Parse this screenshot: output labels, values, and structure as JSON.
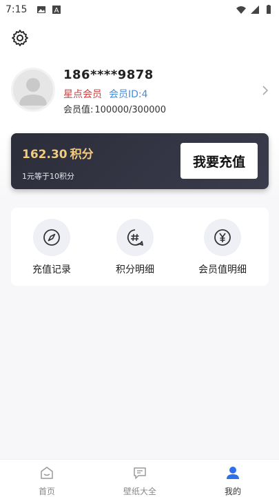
{
  "status_bar": {
    "time": "7:15",
    "icons_left": [
      "image-icon",
      "text-icon"
    ],
    "icons_right": [
      "wifi-icon",
      "signal-icon",
      "battery-icon"
    ]
  },
  "settings": {
    "icon": "gear-icon"
  },
  "profile": {
    "phone": "186****9878",
    "level": "星点会员",
    "member_id": "会员ID:4",
    "points_label": "会员值:",
    "points_value": "100000/300000"
  },
  "recharge": {
    "balance": "162.30",
    "balance_unit": "积分",
    "rate": "1元等于10积分",
    "button_label": "我要充值"
  },
  "menu": [
    {
      "label": "充值记录",
      "icon": "compass-icon"
    },
    {
      "label": "积分明细",
      "icon": "hashtag-chat-icon"
    },
    {
      "label": "会员值明细",
      "icon": "yen-icon"
    }
  ],
  "nav": [
    {
      "label": "首页",
      "icon": "home-icon",
      "active": false
    },
    {
      "label": "壁纸大全",
      "icon": "message-icon",
      "active": false
    },
    {
      "label": "我的",
      "icon": "user-icon",
      "active": true
    }
  ],
  "colors": {
    "level": "#c84040",
    "member_id": "#4a8ad6",
    "balance": "#f3cb7c",
    "card_bg": "#2b2d3a",
    "active_nav": "#2f6fe8"
  }
}
